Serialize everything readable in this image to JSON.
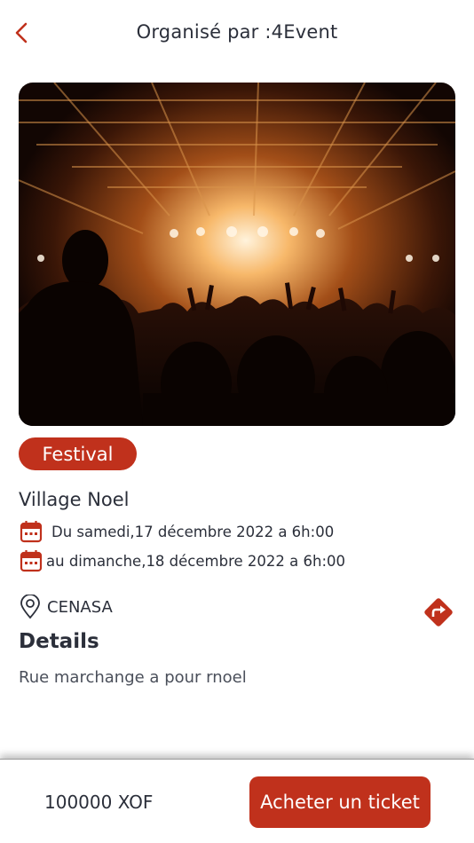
{
  "header": {
    "title": "Organisé par :4Event",
    "back_icon": "chevron-left-icon"
  },
  "event": {
    "category": "Festival",
    "name": "Village Noel",
    "start": "Du samedi,17 décembre 2022 a 6h:00",
    "end": "au dimanche,18 décembre 2022 a 6h:00",
    "location": "CENASA",
    "details_title": "Details",
    "description": "Rue marchange a pour rnoel"
  },
  "footer": {
    "price": "100000 XOF",
    "buy_label": "Acheter un ticket"
  },
  "colors": {
    "accent": "#c0311c",
    "text": "#2b2f3a"
  }
}
